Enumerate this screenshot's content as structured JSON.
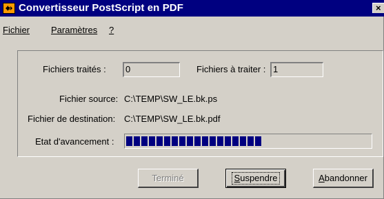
{
  "window": {
    "title": "Convertisseur PostScript en PDF",
    "close_glyph": "×",
    "icon": "app-icon"
  },
  "menu": {
    "items": [
      {
        "label": "Fichier"
      },
      {
        "label": "Paramètres"
      },
      {
        "label": "?"
      }
    ]
  },
  "form": {
    "processed_label": "Fichiers traités :",
    "processed_value": "0",
    "to_process_label": "Fichiers à traiter :",
    "to_process_value": "1",
    "source_label": "Fichier source:",
    "source_value": "C:\\TEMP\\SW_LE.bk.ps",
    "dest_label": "Fichier de destination:",
    "dest_value": "C:\\TEMP\\SW_LE.bk.pdf",
    "progress_label": "Etat d'avancement :",
    "progress_fraction": 0.56
  },
  "buttons": {
    "done": "Terminé",
    "suspend": "Suspendre",
    "abort": "Abandonner"
  },
  "colors": {
    "titlebar": "#000080",
    "progress": "#000080",
    "face": "#d4d0c8"
  }
}
